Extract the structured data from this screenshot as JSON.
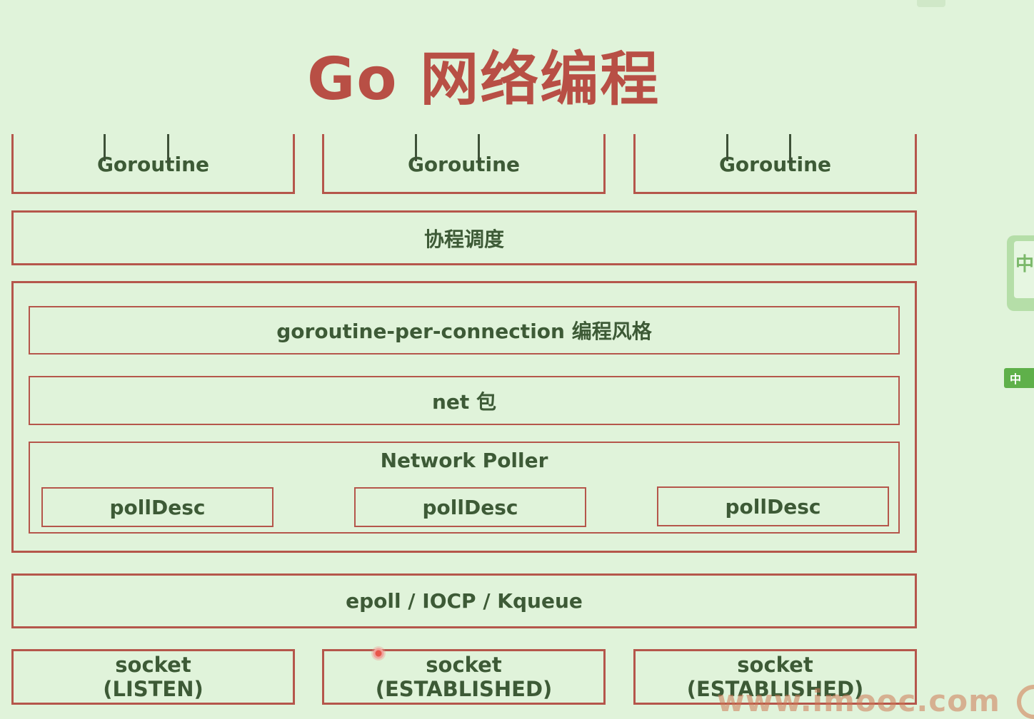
{
  "title": "Go 网络编程",
  "layers": {
    "goroutines": [
      "Goroutine",
      "Goroutine",
      "Goroutine"
    ],
    "scheduler": "协程调度",
    "outer": {
      "style": "goroutine-per-connection 编程风格",
      "net": "net 包",
      "poller": {
        "label": "Network Poller",
        "descs": [
          "pollDesc",
          "pollDesc",
          "pollDesc"
        ]
      }
    },
    "io": "epoll / IOCP / Kqueue",
    "sockets": [
      {
        "line1": "socket",
        "line2": "(LISTEN)"
      },
      {
        "line1": "socket",
        "line2": "(ESTABLISHED)"
      },
      {
        "line1": "socket",
        "line2": "(ESTABLISHED)"
      }
    ]
  },
  "side": {
    "tab_glyph": "中",
    "button_glyph": "中"
  },
  "watermark": "www.imooc.com",
  "colors": {
    "background": "#e0f3da",
    "border": "#b5564b",
    "title": "#b84f45",
    "text": "#3d5a36"
  }
}
